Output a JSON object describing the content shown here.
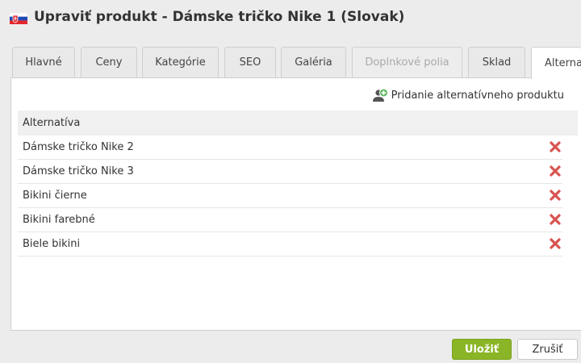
{
  "window": {
    "title": "Upraviť produkt - Dámske tričko Nike 1 (Slovak)",
    "flag_icon": "slovak-flag-icon"
  },
  "tabs": [
    {
      "label": "Hlavné",
      "state": "normal"
    },
    {
      "label": "Ceny",
      "state": "normal"
    },
    {
      "label": "Kategórie",
      "state": "normal"
    },
    {
      "label": "SEO",
      "state": "normal"
    },
    {
      "label": "Galéria",
      "state": "normal"
    },
    {
      "label": "Doplnkové polia",
      "state": "disabled"
    },
    {
      "label": "Sklad",
      "state": "normal"
    },
    {
      "label": "Alterna",
      "state": "active"
    }
  ],
  "panel": {
    "add_label": "Pridanie alternatívneho produktu",
    "add_icon": "add-user-icon",
    "column_header": "Alternatíva",
    "rows": [
      {
        "name": "Dámske tričko Nike 2"
      },
      {
        "name": "Dámske tričko Nike 3"
      },
      {
        "name": "Bikini čierne"
      },
      {
        "name": "Bikini farebné"
      },
      {
        "name": "Biele bikini"
      }
    ],
    "delete_icon": "delete-x-icon"
  },
  "footer": {
    "save_label": "Uložiť",
    "cancel_label": "Zrušiť"
  },
  "colors": {
    "save_button": "#8ab526",
    "delete_icon": "#d9534f",
    "add_icon_plus": "#5cb85c"
  }
}
